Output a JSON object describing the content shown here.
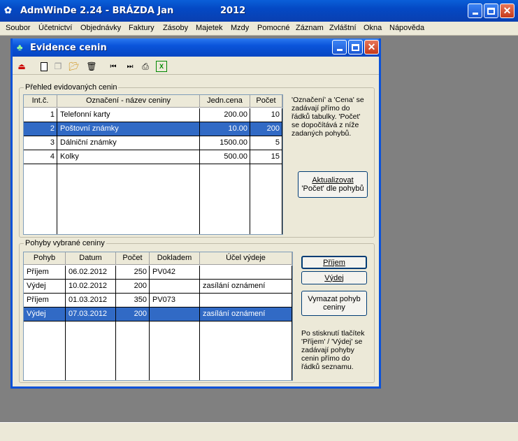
{
  "app": {
    "title": "AdmWinDe 2.24 - BRÁZDA Jan",
    "year": "2012",
    "menu": [
      "Soubor",
      "Účetnictví",
      "Objednávky",
      "Faktury",
      "Zásoby",
      "Majetek",
      "Mzdy",
      "Pomocné",
      "Záznam",
      "Zvláštní",
      "Okna",
      "Nápověda"
    ]
  },
  "window": {
    "title": "Evidence cenin"
  },
  "group1": {
    "legend": "Přehled evidovaných cenin",
    "headers": [
      "Int.č.",
      "Označení - název ceniny",
      "Jedn.cena",
      "Počet"
    ],
    "rows": [
      {
        "id": "1",
        "name": "Telefonní karty",
        "price": "200.00",
        "count": "10",
        "selected": false
      },
      {
        "id": "2",
        "name": "Poštovní známky",
        "price": "10.00",
        "count": "200",
        "selected": true
      },
      {
        "id": "3",
        "name": "Dálniční známky",
        "price": "1500.00",
        "count": "5",
        "selected": false
      },
      {
        "id": "4",
        "name": "Kolky",
        "price": "500.00",
        "count": "15",
        "selected": false
      }
    ],
    "note": "'Označení' a 'Cena' se\nzadávají přímo do\nřádků tabulky. 'Počet'\nse dopočítává z níže\nzadaných pohybů.",
    "update_button_line1": "Aktualizovat",
    "update_button_line2": "'Počet' dle pohybů"
  },
  "group2": {
    "legend": "Pohyby vybrané ceniny",
    "headers": [
      "Pohyb",
      "Datum",
      "Počet",
      "Dokladem",
      "Účel výdeje"
    ],
    "rows": [
      {
        "type": "Příjem",
        "date": "06.02.2012",
        "count": "250",
        "doc": "PV042",
        "purpose": "",
        "selected": false
      },
      {
        "type": "Výdej",
        "date": "10.02.2012",
        "count": "200",
        "doc": "",
        "purpose": "zasílání oznámení",
        "selected": false
      },
      {
        "type": "Příjem",
        "date": "01.03.2012",
        "count": "350",
        "doc": "PV073",
        "purpose": "",
        "selected": false
      },
      {
        "type": "Výdej",
        "date": "07.03.2012",
        "count": "200",
        "doc": "",
        "purpose": "zasílání oznámení",
        "selected": true
      }
    ],
    "btn_prijem": "Příjem",
    "btn_vydej": "Výdej",
    "btn_delete_line1": "Vymazat pohyb",
    "btn_delete_line2": "ceniny",
    "note": "Po stisknutí tlačítek\n'Příjem' / 'Výdej' se\nzadávají pohyby\ncenin přímo do\nřádků seznamu."
  },
  "colors": {
    "selection": "#316ac5",
    "titlebar": "#0a54da",
    "face": "#ece9d8"
  },
  "icons": [
    "exit-icon",
    "new-icon",
    "copy-icon",
    "open-icon",
    "delete-icon",
    "first-icon",
    "last-icon",
    "print-icon",
    "excel-icon"
  ]
}
